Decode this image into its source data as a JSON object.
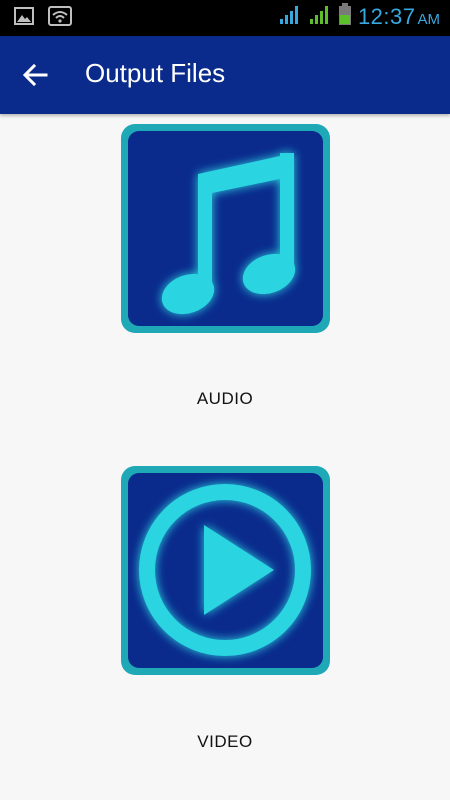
{
  "status_bar": {
    "time": "12:37",
    "ampm": "AM",
    "icons": [
      "image-icon",
      "wifi-icon",
      "signal-icon",
      "signal-icon",
      "battery-icon"
    ]
  },
  "app_bar": {
    "title": "Output Files",
    "back_icon": "arrow-left-icon"
  },
  "items": [
    {
      "label": "AUDIO",
      "icon": "music-note-icon"
    },
    {
      "label": "VIDEO",
      "icon": "play-icon"
    }
  ],
  "colors": {
    "app_bar": "#0a2a8c",
    "tile_border": "#1fa9b6",
    "icon_glow": "#2ad4e0",
    "status_blue": "#38a8e0",
    "signal_green": "#5cc02a"
  }
}
